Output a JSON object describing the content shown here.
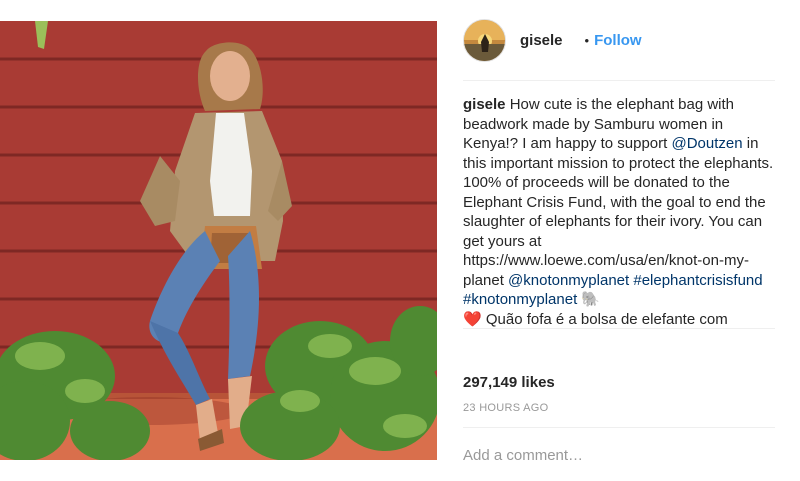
{
  "post": {
    "photo_icon": "post-photo",
    "header": {
      "avatar_icon": "avatar-sunset",
      "username": "gisele",
      "separator": "•",
      "follow_label": "Follow"
    },
    "caption": {
      "author": "gisele",
      "segments": [
        " How cute is the elephant bag with beadwork made by Samburu women in Kenya!? I am happy to support ",
        "@Doutzen",
        " in this important mission to protect the elephants. 100% of proceeds will be donated to the Elephant Crisis Fund, with the goal to end the slaughter of elephants for their ivory. You can get yours at https://www.loewe.com/usa/en/knot-on-my-planet ",
        "@knotonmyplanet",
        " ",
        "#elephantcrisisfund",
        " ",
        "#knotonmyplanet",
        " 🐘 ",
        "❤️",
        " Quão fofa é a bolsa de elefante com"
      ]
    },
    "likes": "297,149 likes",
    "timestamp": "23 HOURS AGO",
    "comment_placeholder": "Add a comment…"
  },
  "colors": {
    "link": "#003569",
    "follow": "#3897f0",
    "muted": "#999999",
    "wall": "#a63a33"
  }
}
